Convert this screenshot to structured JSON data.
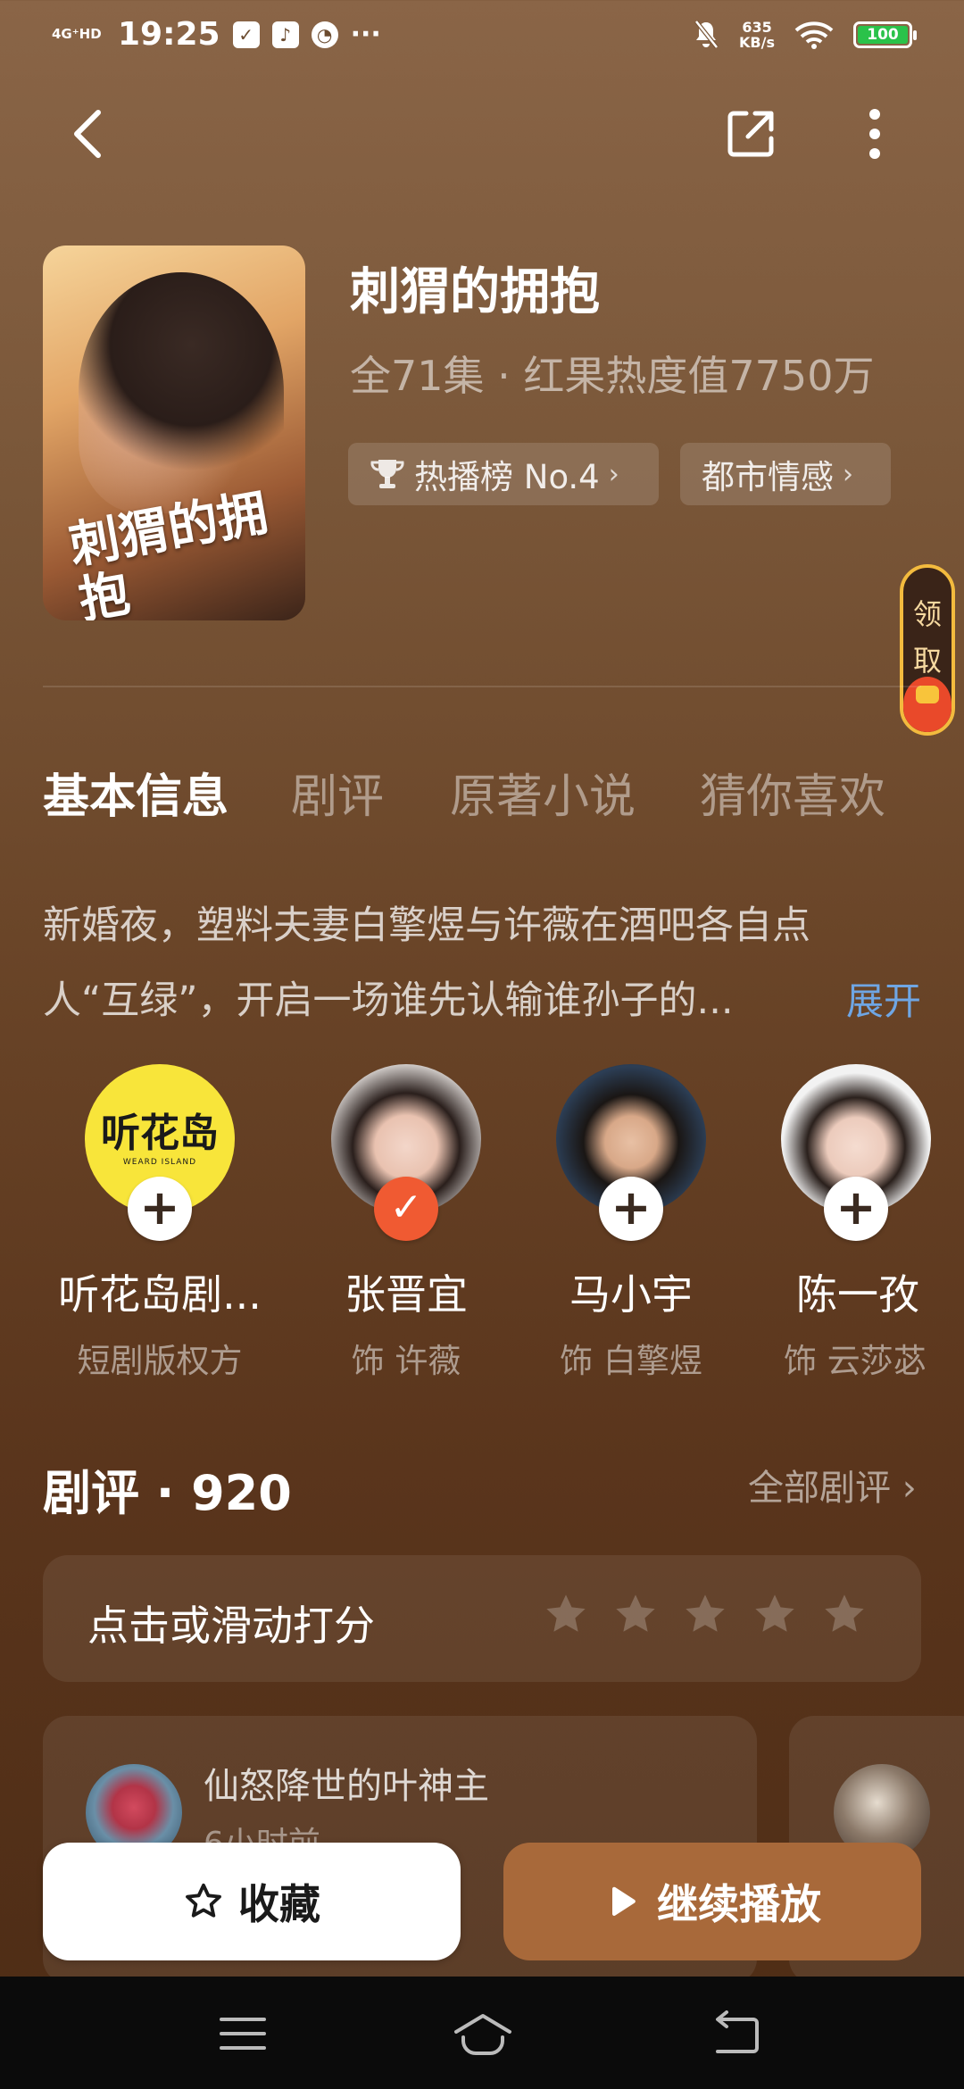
{
  "status_bar": {
    "network": "4G⁺HD",
    "time": "19:25",
    "more": "···",
    "speed_value": "635",
    "speed_unit": "KB/s",
    "battery": "100",
    "icons": [
      "sim-signal-icon",
      "clipboard-check-icon",
      "music-app-icon",
      "speed-app-icon",
      "mute-bell-icon",
      "wifi-icon",
      "battery-icon"
    ]
  },
  "top_bar": {
    "icons": [
      "back-icon",
      "share-icon",
      "more-vertical-icon"
    ]
  },
  "show": {
    "title": "刺猬的拥抱",
    "meta": "全71集 · 红果热度值7750万",
    "poster_title": "刺猬的拥抱",
    "tags": [
      {
        "label": "热播榜 No.4",
        "icon": "trophy-icon"
      },
      {
        "label": "都市情感",
        "icon": ""
      }
    ]
  },
  "reward": {
    "label_line1": "领",
    "label_line2": "取",
    "icon": "red-envelope-icon"
  },
  "tabs": [
    {
      "label": "基本信息",
      "active": true
    },
    {
      "label": "剧评",
      "active": false
    },
    {
      "label": "原著小说",
      "active": false
    },
    {
      "label": "猜你喜欢",
      "active": false
    }
  ],
  "synopsis": {
    "text": "新婚夜，塑料夫妻白擎煜与许薇在酒吧各自点人“互绿”，开启一场谁先认输谁孙子的...",
    "expand_label": "展开"
  },
  "cast": [
    {
      "name": "听花岛剧...",
      "role": "短剧版权方",
      "followed": false,
      "logo_text": "听花岛",
      "logo_sub": "WEARD ISLAND"
    },
    {
      "name": "张晋宜",
      "role": "饰 许薇",
      "followed": true
    },
    {
      "name": "马小宇",
      "role": "饰 白擎煜",
      "followed": false
    },
    {
      "name": "陈一孜",
      "role": "饰 云莎苾",
      "followed": false
    }
  ],
  "reviews": {
    "title": "剧评 · 920",
    "all_label": "全部剧评",
    "rate_label": "点击或滑动打分",
    "rating": 0,
    "max_rating": 5,
    "cards": [
      {
        "user": "仙怒降世的叶神主",
        "time": "6小时前"
      }
    ]
  },
  "actions": {
    "collect_label": "收藏",
    "play_label": "继续播放"
  },
  "nav": {
    "icons": [
      "menu-icon",
      "home-icon",
      "back-nav-icon"
    ]
  },
  "colors": {
    "accent_blue": "#6fa6e4",
    "play_button": "#a8693a",
    "follow_checked": "#f05a32",
    "reward_border": "#f3bb3e"
  }
}
